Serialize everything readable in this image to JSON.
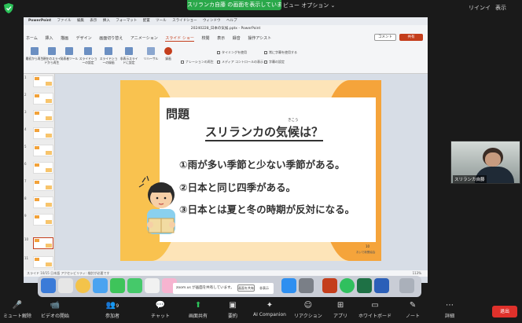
{
  "zoom": {
    "share_banner": "スリランカ自藤 の画面を表示しています",
    "view_options": "ビュー オプション ⌄",
    "top_right": [
      "リインイ",
      "表示"
    ]
  },
  "mac": {
    "menubar": [
      "PowerPoint",
      "ファイル",
      "編集",
      "表示",
      "挿入",
      "フォーマット",
      "配置",
      "ツール",
      "スライドショー",
      "ウィンドウ",
      "ヘルプ"
    ],
    "ppt_title": "20240228_日本の気候.pptx - PowerPoint",
    "ribbon_tabs": [
      "ホーム",
      "挿入",
      "描画",
      "デザイン",
      "画面切り替え",
      "アニメーション",
      "スライド ショー",
      "校閲",
      "表示",
      "録音",
      "操作アシスト"
    ],
    "active_tab": "スライド ショー",
    "comment": "コメント",
    "share": "共有",
    "tools": [
      "最初から再生",
      "現在のスライドから再生",
      "発表者ツール",
      "スライドショーの設定",
      "スライドショーの録画",
      "非表示スライドに設定",
      "リハーサル",
      "録画"
    ],
    "checks": [
      "ナレーションの再生",
      "タイミングを使用",
      "メディア コントロールの表示",
      "常に字幕を使用する",
      "字幕の設定"
    ],
    "status": "スライド 10/15  日本語  アクセシビリティ: 検討が必要です",
    "zoom_level": "113%"
  },
  "slide": {
    "title": "問題",
    "ruby": "きこう",
    "question": "スリランカの気候は？",
    "options": [
      "①雨が多い季節と少ない季節がある。",
      "②日本と同じ四季がある。",
      "③日本とは夏と冬の時期が反対になる。"
    ],
    "number": "10",
    "credit": "おいで新聞協会"
  },
  "thumbs": [
    "1",
    "2",
    "3",
    "4",
    "5",
    "6",
    "7",
    "8",
    "9",
    "10",
    "11"
  ],
  "notice": {
    "text": "zoom.us が画面を共有しています。",
    "share": "画面を共有",
    "close": "非表示"
  },
  "video": {
    "name": "スリランカ自藤"
  },
  "toolbar": [
    {
      "icon": "🎤",
      "label": "ミュート解除"
    },
    {
      "icon": "📹",
      "label": "ビデオの開始"
    },
    {
      "icon": "👥",
      "label": "参加者"
    },
    {
      "icon": "💬",
      "label": "チャット"
    },
    {
      "icon": "⬆",
      "label": "画面共有"
    },
    {
      "icon": "▣",
      "label": "要約"
    },
    {
      "icon": "✦",
      "label": "AI Companion"
    },
    {
      "icon": "☺",
      "label": "リアクション"
    },
    {
      "icon": "⊞",
      "label": "アプリ"
    },
    {
      "icon": "▭",
      "label": "ホワイトボード"
    },
    {
      "icon": "✎",
      "label": "ノート"
    },
    {
      "icon": "⋯",
      "label": "詳細"
    }
  ],
  "participant_count": "9",
  "end": "退出",
  "colors": {
    "share_green": "#2aa84a",
    "ppt_accent": "#c43e1c",
    "end_red": "#e0312b",
    "slide_bg": "#fde4b8"
  }
}
